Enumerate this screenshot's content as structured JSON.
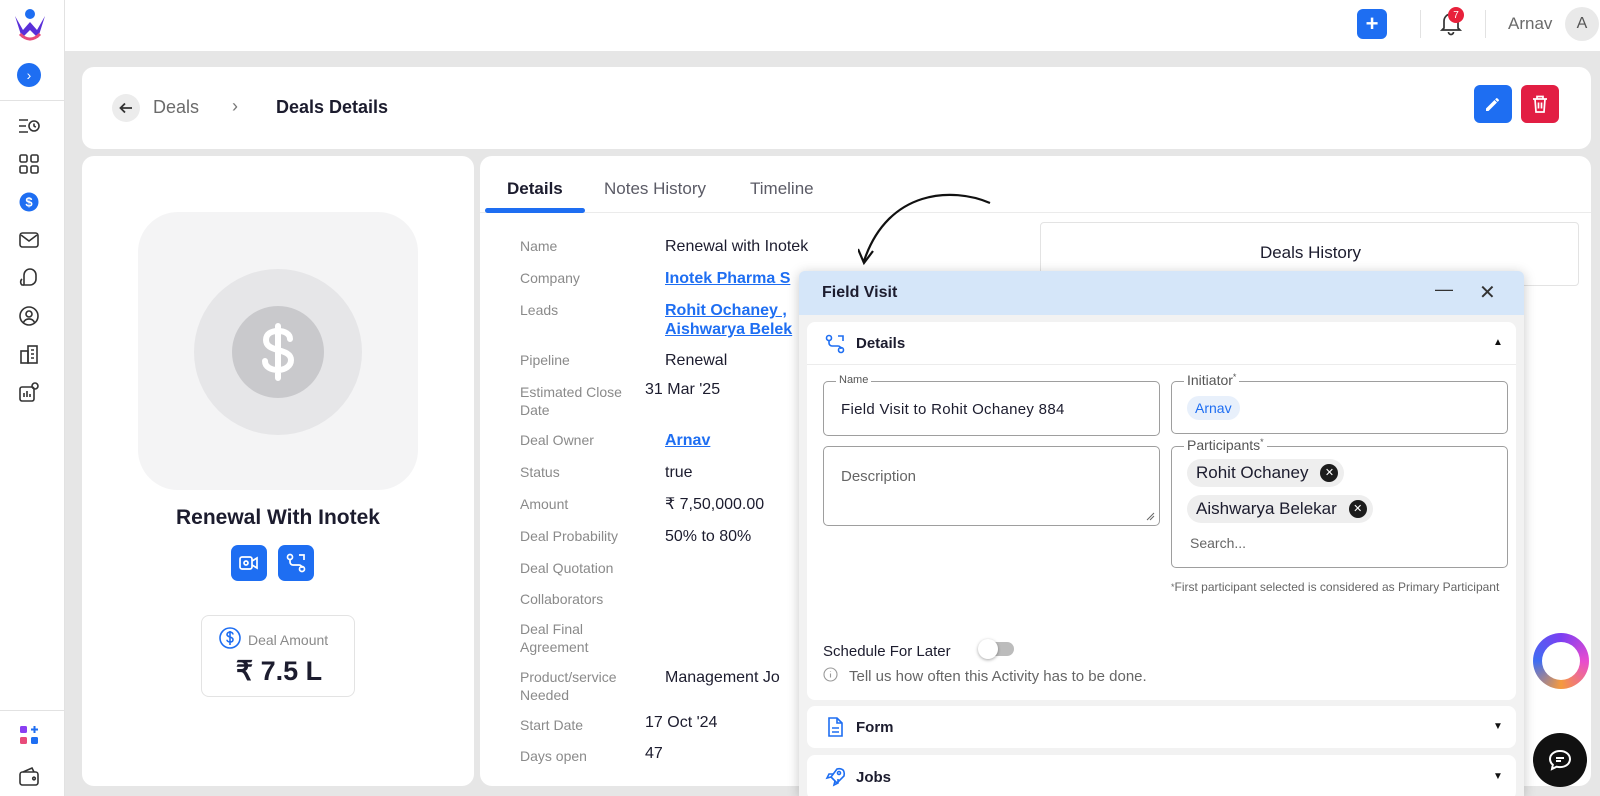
{
  "topbar": {
    "notification_count": "7",
    "user_name": "Arnav",
    "user_initial": "A",
    "add_label": "+"
  },
  "breadcrumb": {
    "parent": "Deals",
    "current": "Deals Details"
  },
  "deal": {
    "title": "Renewal With Inotek",
    "amount_label": "Deal Amount",
    "amount_value": "₹ 7.5 L"
  },
  "tabs": [
    {
      "label": "Details",
      "active": true
    },
    {
      "label": "Notes History",
      "active": false
    },
    {
      "label": "Timeline",
      "active": false
    }
  ],
  "fields": {
    "name": {
      "label": "Name",
      "value": "Renewal with Inotek"
    },
    "company": {
      "label": "Company",
      "value": "Inotek Pharma S"
    },
    "leads": {
      "label": "Leads",
      "value1": "Rohit Ochaney ,",
      "value2": "Aishwarya Belek"
    },
    "pipeline": {
      "label": "Pipeline",
      "value": "Renewal"
    },
    "close_date": {
      "label": "Estimated Close Date",
      "value": "31 Mar '25"
    },
    "owner": {
      "label": "Deal Owner",
      "value": "Arnav"
    },
    "status": {
      "label": "Status",
      "value": "true"
    },
    "amount": {
      "label": "Amount",
      "value": "₹ 7,50,000.00"
    },
    "probability": {
      "label": "Deal Probability",
      "value": "50% to 80%"
    },
    "quotation": {
      "label": "Deal Quotation",
      "value": ""
    },
    "collaborators": {
      "label": "Collaborators",
      "value": ""
    },
    "final_agreement": {
      "label": "Deal Final Agreement",
      "value": ""
    },
    "product": {
      "label": "Product/service Needed",
      "value": "Management Jo"
    },
    "start_date": {
      "label": "Start Date",
      "value": "17 Oct '24"
    },
    "days_open": {
      "label": "Days open",
      "value": "47"
    }
  },
  "history": {
    "title": "Deals History"
  },
  "modal": {
    "title": "Field Visit",
    "details_section": "Details",
    "name_label": "Name",
    "name_value": "Field Visit to Rohit Ochaney 884",
    "initiator_label": "Initiator",
    "initiator_value": "Arnav",
    "description_placeholder": "Description",
    "participants_label": "Participants",
    "participants": [
      "Rohit Ochaney",
      "Aishwarya Belekar"
    ],
    "search_placeholder": "Search...",
    "primary_note": "First participant selected is considered as Primary Participant",
    "schedule_label": "Schedule For Later",
    "schedule_enabled": false,
    "info_text": "Tell us how often this Activity has to be done.",
    "form_section": "Form",
    "jobs_section": "Jobs",
    "required_mark": "*"
  },
  "colors": {
    "primary": "#1e6ef2",
    "danger": "#e21e43",
    "modal_header": "#d5e6f9"
  },
  "icons": {
    "sidebar": [
      "activity-list-icon",
      "dashboard-grid-icon",
      "dollar-icon",
      "mail-icon",
      "chat-icon",
      "user-circle-icon",
      "building-icon",
      "settings-chart-icon",
      "apps-add-icon",
      "wallet-icon"
    ]
  }
}
